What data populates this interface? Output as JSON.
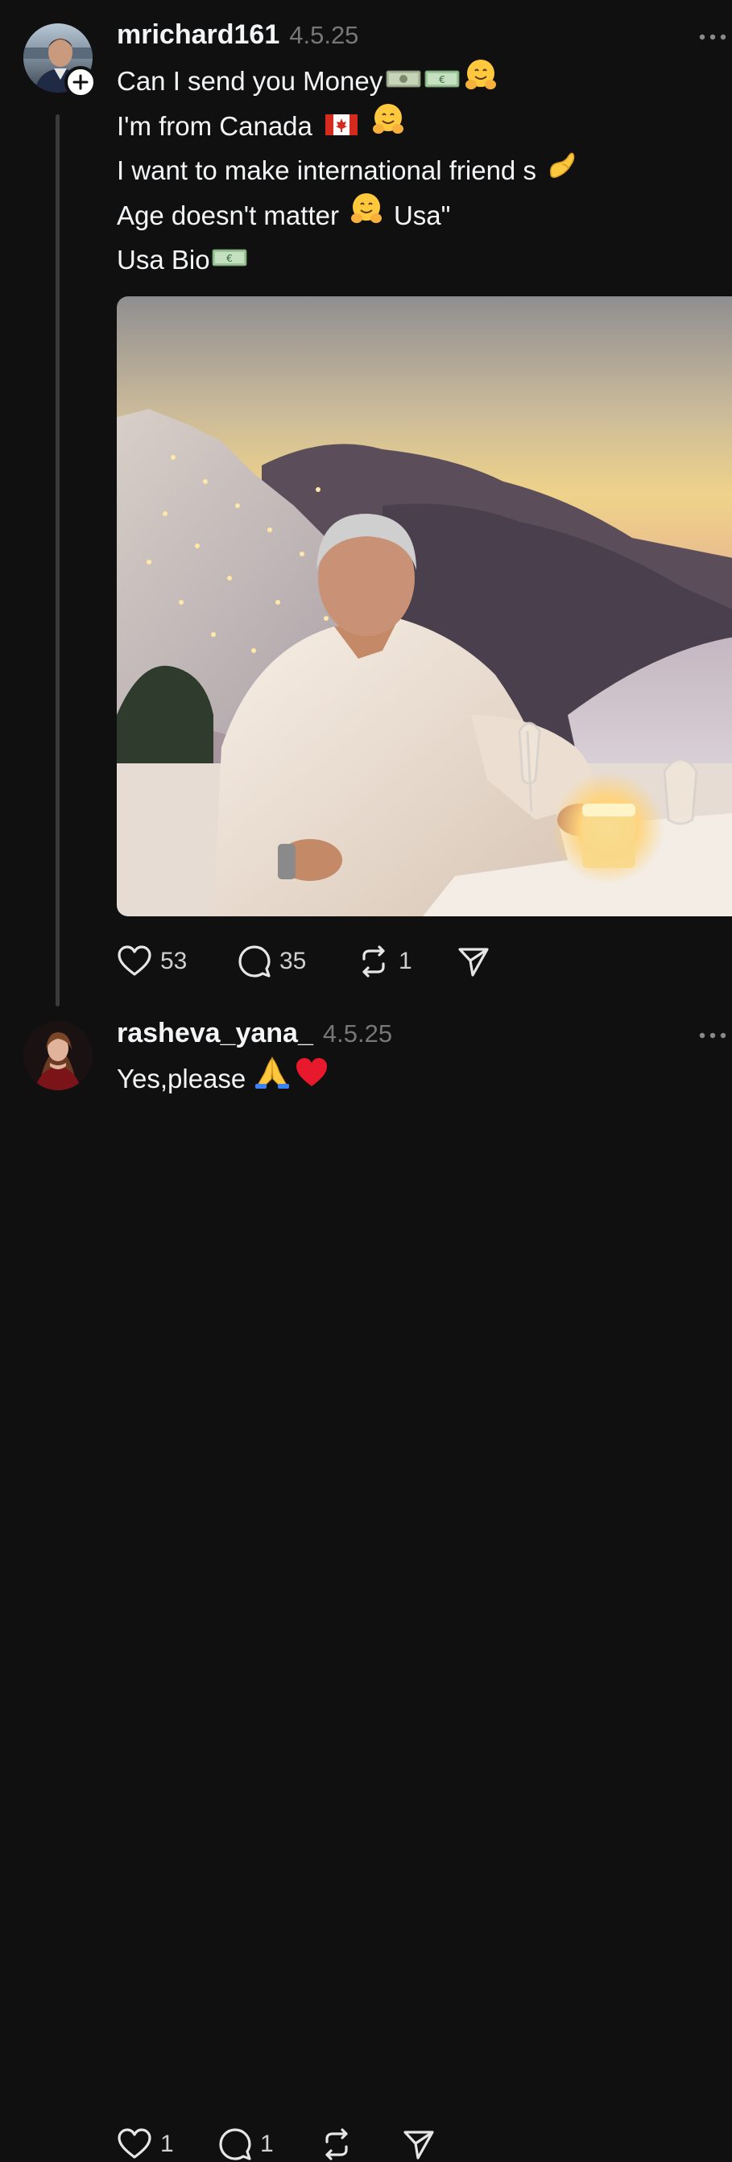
{
  "posts": [
    {
      "username": "mrichard161",
      "timestamp": "4.5.25",
      "lines": [
        "Can I send you Money",
        "I'm from Canada",
        "I want to make international friend s",
        "Age doesn't matter",
        "Usa\"",
        "Usa Bio"
      ],
      "actions": {
        "likes": "53",
        "replies": "35",
        "reposts": "1"
      }
    },
    {
      "username": "rasheva_yana_",
      "timestamp": "4.5.25",
      "lines": [
        "Yes,please"
      ],
      "actions": {
        "likes": "1",
        "replies": "1"
      }
    }
  ],
  "icons": {
    "like": "heart-icon",
    "reply": "speech-bubble-icon",
    "repost": "repost-icon",
    "share": "paper-plane-icon",
    "more": "more-dots-icon",
    "follow": "plus-icon"
  },
  "colors": {
    "background": "#101010",
    "text": "#f3f5f7",
    "muted": "#777777",
    "thread_line": "#3a3a3a"
  }
}
